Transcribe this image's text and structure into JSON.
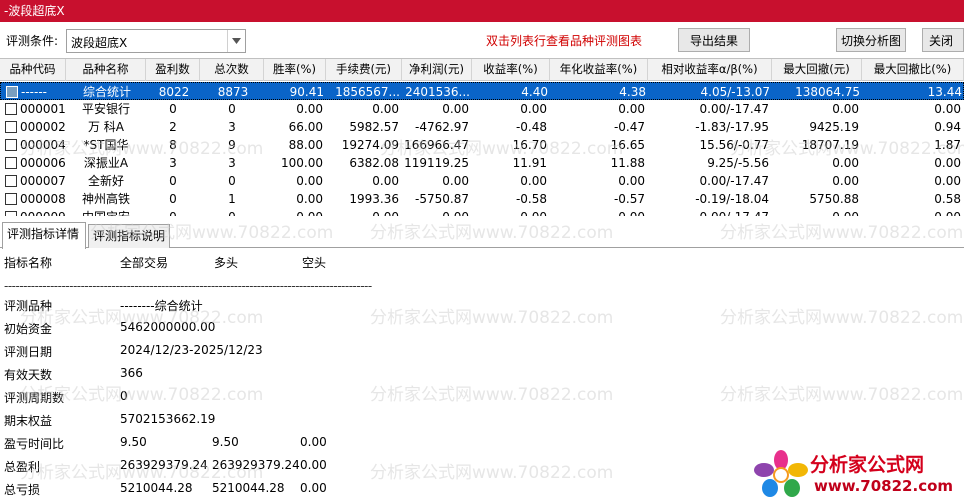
{
  "window": {
    "title": "-波段超底X"
  },
  "toolbar": {
    "condition_label": "评测条件:",
    "condition_value": "波段超底X",
    "hint": "双击列表行查看品种评测图表",
    "export_label": "导出结果",
    "switch_label": "切换分析图",
    "close_label": "关闭"
  },
  "grid": {
    "columns": [
      "品种代码",
      "品种名称",
      "盈利数",
      "总次数",
      "胜率(%)",
      "手续费(元)",
      "净利润(元)",
      "收益率(%)",
      "年化收益率(%)",
      "相对收益率α/β(%)",
      "最大回撤(元)",
      "最大回撤比(%)"
    ],
    "rows": [
      [
        "------",
        "综合统计",
        "8022",
        "8873",
        "90.41",
        "1856567...",
        "2401536...",
        "4.40",
        "4.38",
        "4.05/-13.07",
        "138064.75",
        "13.44"
      ],
      [
        "000001",
        "平安银行",
        "0",
        "0",
        "0.00",
        "0.00",
        "0.00",
        "0.00",
        "0.00",
        "0.00/-17.47",
        "0.00",
        "0.00"
      ],
      [
        "000002",
        "万 科A",
        "2",
        "3",
        "66.00",
        "5982.57",
        "-4762.97",
        "-0.48",
        "-0.47",
        "-1.83/-17.95",
        "9425.19",
        "0.94"
      ],
      [
        "000004",
        "*ST国华",
        "8",
        "9",
        "88.00",
        "19274.09",
        "166966.47",
        "16.70",
        "16.65",
        "15.56/-0.77",
        "18707.19",
        "1.87"
      ],
      [
        "000006",
        "深振业A",
        "3",
        "3",
        "100.00",
        "6382.08",
        "119119.25",
        "11.91",
        "11.88",
        "9.25/-5.56",
        "0.00",
        "0.00"
      ],
      [
        "000007",
        "全新好",
        "0",
        "0",
        "0.00",
        "0.00",
        "0.00",
        "0.00",
        "0.00",
        "0.00/-17.47",
        "0.00",
        "0.00"
      ],
      [
        "000008",
        "神州高铁",
        "0",
        "1",
        "0.00",
        "1993.36",
        "-5750.87",
        "-0.58",
        "-0.57",
        "-0.19/-18.04",
        "5750.88",
        "0.58"
      ],
      [
        "000009",
        "中国宝安",
        "0",
        "0",
        "0.00",
        "0.00",
        "0.00",
        "0.00",
        "0.00",
        "0.00/-17.47",
        "0.00",
        "0.00"
      ]
    ]
  },
  "tabs": [
    {
      "label": "评测指标详情"
    },
    {
      "label": "评测指标说明"
    }
  ],
  "details": {
    "header": [
      "指标名称",
      "全部交易",
      "多头",
      "空头"
    ],
    "separator": "------------------------------------------------------------------------------------------------",
    "lines": [
      {
        "name": "评测品种",
        "values": [
          "--------综合统计",
          "",
          ""
        ]
      },
      {
        "name": "初始资金",
        "values": [
          "5462000000.00",
          "",
          ""
        ]
      },
      {
        "name": "评测日期",
        "values": [
          "2024/12/23-2025/12/23",
          "",
          ""
        ]
      },
      {
        "name": "有效天数",
        "values": [
          "366",
          "",
          ""
        ]
      },
      {
        "name": "评测周期数",
        "values": [
          "0",
          "",
          ""
        ]
      },
      {
        "name": "期末权益",
        "values": [
          "5702153662.19",
          "",
          ""
        ]
      },
      {
        "name": "盈亏时间比",
        "values": [
          "9.50",
          "9.50",
          "0.00"
        ]
      },
      {
        "name": "总盈利",
        "values": [
          "263929379.24",
          "263929379.24",
          "0.00"
        ]
      },
      {
        "name": "总亏损",
        "values": [
          "5210044.28",
          "5210044.28",
          "0.00"
        ]
      }
    ]
  },
  "watermark": {
    "text": "分析家公式网www.70822.com"
  },
  "logo": {
    "title": "分析家公式网",
    "url": "www.70822.com"
  },
  "colors": {
    "titlebar": "#c8102e",
    "selection": "#0a64c8",
    "hint": "#d00000"
  }
}
